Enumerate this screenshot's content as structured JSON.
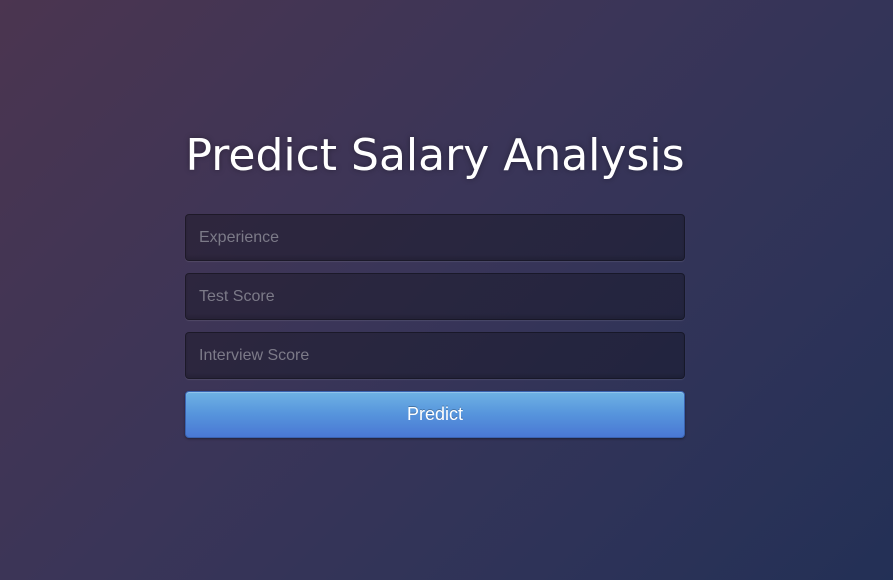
{
  "page": {
    "title": "Predict Salary Analysis"
  },
  "form": {
    "experience": {
      "placeholder": "Experience",
      "value": ""
    },
    "test_score": {
      "placeholder": "Test Score",
      "value": ""
    },
    "interview_score": {
      "placeholder": "Interview Score",
      "value": ""
    },
    "submit_label": "Predict"
  },
  "colors": {
    "button_top": "#6eb2e4",
    "button_bottom": "#4a78d4",
    "title_text": "#ffffff"
  }
}
